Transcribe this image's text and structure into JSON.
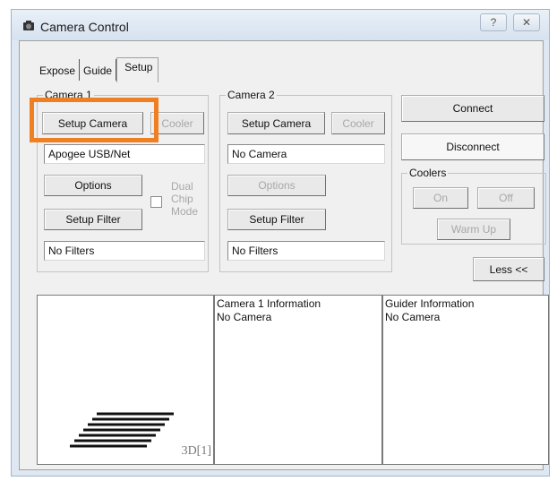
{
  "window": {
    "title": "Camera Control",
    "help_glyph": "?",
    "close_glyph": "✕"
  },
  "tabs": [
    {
      "label": "Expose",
      "active": false
    },
    {
      "label": "Guide",
      "active": false
    },
    {
      "label": "Setup",
      "active": true
    }
  ],
  "camera1": {
    "group_label": "Camera 1",
    "setup_camera": "Setup Camera",
    "cooler": "Cooler",
    "camera_name": "Apogee USB/Net",
    "options": "Options",
    "dual_chip_lines": [
      "Dual",
      "Chip",
      "Mode"
    ],
    "setup_filter": "Setup Filter",
    "filters": "No Filters"
  },
  "camera2": {
    "group_label": "Camera 2",
    "setup_camera": "Setup Camera",
    "cooler": "Cooler",
    "camera_name": "No Camera",
    "options": "Options",
    "setup_filter": "Setup Filter",
    "filters": "No Filters"
  },
  "right": {
    "connect": "Connect",
    "disconnect": "Disconnect",
    "coolers_label": "Coolers",
    "on": "On",
    "off": "Off",
    "warm_up": "Warm Up",
    "less": "Less <<"
  },
  "info": {
    "preview_label": "3D[1]",
    "camera1_title": "Camera 1 Information",
    "camera1_value": "No Camera",
    "guider_title": "Guider Information",
    "guider_value": "No Camera"
  },
  "colors": {
    "highlight": "#f07f22"
  }
}
